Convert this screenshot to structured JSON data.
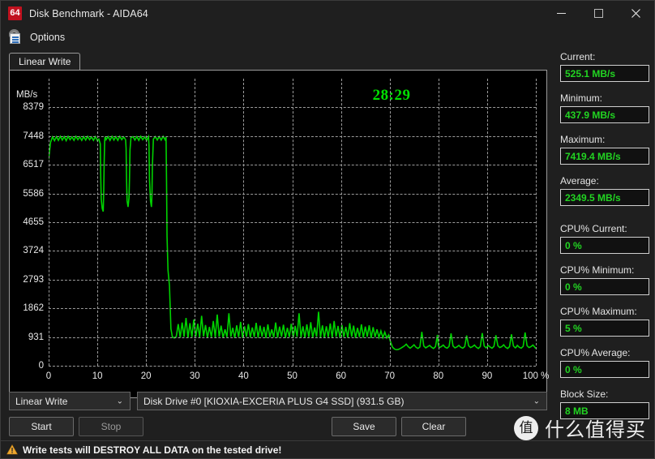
{
  "window": {
    "title": "Disk Benchmark - AIDA64",
    "icon_label": "64",
    "minimize_label": "minimize",
    "maximize_label": "maximize",
    "close_label": "close"
  },
  "toolbar": {
    "options_label": "Options"
  },
  "tabs": [
    {
      "label": "Linear Write",
      "active": true
    }
  ],
  "chart": {
    "timer": "28:29",
    "unit": "MB/s",
    "accent_color": "#00e000",
    "trace_color": "#00d200",
    "grid_color": "#9b9b9b",
    "background": "#000000"
  },
  "chart_data": {
    "type": "line",
    "title": "Linear Write",
    "xlabel": "",
    "ylabel": "MB/s",
    "grid": true,
    "legend": false,
    "xlim": [
      0,
      100
    ],
    "ylim": [
      0,
      9310
    ],
    "xticks": [
      0,
      10,
      20,
      30,
      40,
      50,
      60,
      70,
      80,
      90,
      100
    ],
    "xticklabels": [
      "0",
      "10",
      "20",
      "30",
      "40",
      "50",
      "60",
      "70",
      "80",
      "90",
      "100 %"
    ],
    "yticks": [
      0,
      931,
      1862,
      2793,
      3724,
      4655,
      5586,
      6517,
      7448,
      8379
    ],
    "yticklabels": [
      "0",
      "931",
      "1862",
      "2793",
      "3724",
      "4655",
      "5586",
      "6517",
      "7448",
      "8379"
    ],
    "series": [
      {
        "name": "Linear Write",
        "color": "#00d200",
        "x": [
          0.0,
          0.4,
          0.8,
          1.2,
          1.6,
          2.0,
          2.4,
          2.8,
          3.2,
          3.6,
          4.0,
          4.4,
          4.8,
          5.2,
          5.6,
          6.0,
          6.4,
          6.8,
          7.2,
          7.6,
          8.0,
          8.4,
          8.8,
          9.2,
          9.6,
          10.0,
          10.3,
          10.6,
          10.7,
          10.8,
          11.0,
          11.2,
          11.3,
          11.4,
          11.5,
          11.6,
          11.8,
          12.2,
          12.6,
          13.0,
          13.4,
          13.8,
          14.2,
          14.6,
          15.0,
          15.4,
          15.8,
          15.9,
          16.0,
          16.1,
          16.3,
          16.5,
          16.6,
          16.7,
          16.9,
          17.3,
          17.7,
          18.1,
          18.5,
          18.9,
          19.3,
          19.7,
          20.1,
          20.5,
          20.6,
          20.7,
          20.9,
          21.1,
          21.2,
          21.3,
          21.5,
          21.9,
          22.3,
          22.7,
          23.1,
          23.5,
          23.9,
          24.1,
          24.2,
          24.3,
          24.5,
          24.8,
          25.1,
          25.4,
          25.8,
          26.2,
          26.6,
          27.0,
          27.4,
          27.8,
          28.2,
          28.6,
          29.0,
          29.4,
          29.8,
          30.2,
          30.6,
          31.0,
          31.4,
          31.8,
          32.2,
          32.6,
          33.0,
          33.4,
          33.8,
          34.2,
          34.6,
          35.0,
          35.4,
          35.8,
          36.2,
          36.6,
          37.0,
          37.4,
          37.8,
          38.2,
          38.6,
          39.0,
          39.4,
          39.8,
          40.2,
          40.6,
          41.0,
          41.4,
          41.8,
          42.2,
          42.6,
          43.0,
          43.4,
          43.8,
          44.2,
          44.6,
          45.0,
          45.4,
          45.8,
          46.2,
          46.6,
          47.0,
          47.4,
          47.8,
          48.2,
          48.6,
          49.0,
          49.4,
          49.8,
          50.2,
          50.6,
          51.0,
          51.4,
          51.8,
          52.2,
          52.6,
          53.0,
          53.4,
          53.8,
          54.2,
          54.6,
          55.0,
          55.4,
          55.8,
          56.2,
          56.6,
          57.0,
          57.4,
          57.8,
          58.2,
          58.6,
          59.0,
          59.4,
          59.8,
          60.2,
          60.6,
          61.0,
          61.4,
          61.8,
          62.2,
          62.6,
          63.0,
          63.4,
          63.8,
          64.2,
          64.6,
          65.0,
          65.4,
          65.8,
          66.2,
          66.6,
          67.0,
          67.4,
          67.8,
          68.2,
          68.6,
          69.0,
          69.4,
          69.8,
          70.0,
          70.2,
          70.6,
          71.0,
          71.4,
          71.8,
          72.2,
          72.6,
          73.0,
          73.4,
          73.8,
          74.2,
          74.6,
          75.0,
          75.4,
          75.8,
          76.2,
          76.6,
          77.0,
          77.4,
          77.8,
          78.2,
          78.6,
          79.0,
          79.4,
          79.8,
          80.0,
          80.2,
          80.6,
          81.0,
          81.4,
          81.8,
          82.2,
          82.6,
          83.0,
          83.4,
          83.8,
          84.2,
          84.6,
          85.0,
          85.4,
          85.8,
          86.2,
          86.6,
          87.0,
          87.4,
          87.8,
          88.2,
          88.6,
          89.0,
          89.4,
          89.8,
          90.0,
          90.2,
          90.6,
          91.0,
          91.4,
          91.8,
          92.2,
          92.6,
          93.0,
          93.4,
          93.8,
          94.2,
          94.6,
          95.0,
          95.4,
          95.8,
          96.0,
          96.2,
          96.6,
          97.0,
          97.4,
          97.8,
          98.2,
          98.6,
          99.0,
          99.4,
          99.8,
          100.0
        ],
        "y": [
          6700,
          7250,
          7420,
          7300,
          7430,
          7310,
          7440,
          7320,
          7430,
          7300,
          7440,
          7330,
          7420,
          7310,
          7440,
          7330,
          7420,
          7310,
          7430,
          7320,
          7440,
          7330,
          7420,
          7310,
          7430,
          7300,
          7350,
          7200,
          6100,
          5400,
          5100,
          5000,
          5600,
          6600,
          7300,
          7430,
          7330,
          7430,
          7310,
          7440,
          7320,
          7430,
          7310,
          7440,
          7330,
          7420,
          7330,
          7050,
          6000,
          5350,
          5150,
          5450,
          6100,
          7000,
          7400,
          7430,
          7320,
          7430,
          7310,
          7440,
          7330,
          7420,
          7310,
          7430,
          7150,
          6050,
          5350,
          5150,
          5500,
          6500,
          7350,
          7430,
          7320,
          7430,
          7320,
          7440,
          7330,
          7420,
          6000,
          4200,
          3100,
          2600,
          1200,
          930,
          900,
          950,
          1350,
          920,
          1400,
          940,
          1550,
          900,
          1380,
          930,
          1500,
          940,
          1360,
          920,
          1620,
          950,
          1320,
          900,
          1260,
          930,
          1450,
          920,
          1660,
          940,
          1300,
          910,
          1180,
          930,
          1700,
          940,
          1230,
          900,
          1310,
          930,
          1420,
          910,
          1280,
          940,
          1350,
          920,
          1240,
          930,
          1390,
          910,
          1300,
          940,
          1260,
          900,
          1340,
          930,
          1180,
          920,
          1400,
          910,
          1270,
          940,
          1330,
          900,
          1230,
          930,
          1360,
          910,
          1290,
          940,
          1700,
          920,
          1280,
          900,
          1340,
          930,
          1410,
          910,
          1240,
          940,
          1750,
          920,
          1310,
          900,
          1280,
          930,
          1370,
          910,
          1450,
          940,
          1290,
          900,
          1320,
          930,
          1260,
          910,
          1380,
          940,
          1300,
          900,
          1230,
          930,
          1340,
          910,
          1270,
          940,
          1310,
          900,
          1250,
          930,
          1180,
          920,
          1130,
          910,
          1090,
          900,
          1000,
          880,
          760,
          600,
          540,
          520,
          530,
          560,
          600,
          640,
          700,
          620,
          570,
          620,
          680,
          600,
          560,
          610,
          1100,
          640,
          580,
          620,
          660,
          600,
          560,
          620,
          1000,
          650,
          590,
          620,
          670,
          600,
          570,
          630,
          1050,
          640,
          580,
          610,
          660,
          600,
          570,
          620,
          980,
          650,
          590,
          620,
          670,
          600,
          560,
          620,
          1060,
          640,
          580,
          610,
          660,
          610,
          570,
          630,
          990,
          650,
          590,
          620,
          680,
          600,
          560,
          620,
          1020,
          640,
          580,
          610,
          660,
          600,
          570,
          630,
          1080,
          650,
          590,
          620,
          670,
          600,
          560,
          620,
          1000,
          640,
          580,
          610,
          660,
          600,
          570,
          630,
          1140,
          650,
          590,
          620,
          670,
          600,
          560,
          625,
          1070,
          640,
          660
        ]
      }
    ]
  },
  "stats": [
    {
      "label": "Current:",
      "value": "525.1 MB/s"
    },
    {
      "label": "Minimum:",
      "value": "437.9 MB/s"
    },
    {
      "label": "Maximum:",
      "value": "7419.4 MB/s"
    },
    {
      "label": "Average:",
      "value": "2349.5 MB/s"
    },
    {
      "label": "CPU% Current:",
      "value": "0 %",
      "gap_before": true
    },
    {
      "label": "CPU% Minimum:",
      "value": "0 %"
    },
    {
      "label": "CPU% Maximum:",
      "value": "5 %"
    },
    {
      "label": "CPU% Average:",
      "value": "0 %"
    },
    {
      "label": "Block Size:",
      "value": "8 MB"
    }
  ],
  "controls": {
    "mode_select": {
      "value": "Linear Write",
      "caret": "⌄"
    },
    "drive_select": {
      "value": "Disk Drive #0  [KIOXIA-EXCERIA PLUS G4 SSD]  (931.5 GB)",
      "caret": "⌄"
    },
    "start_button": "Start",
    "stop_button": "Stop",
    "save_button": "Save",
    "clear_button": "Clear"
  },
  "warning": {
    "text": "Write tests will DESTROY ALL DATA on the tested drive!"
  },
  "watermark": {
    "badge": "值",
    "text": "什么值得买"
  }
}
